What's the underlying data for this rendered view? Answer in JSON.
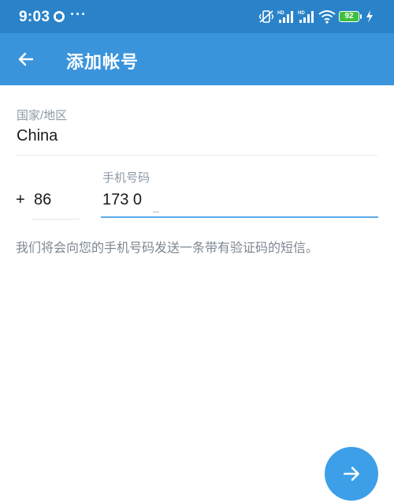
{
  "status_bar": {
    "time": "9:03",
    "more": "···",
    "battery_level": "92"
  },
  "app_bar": {
    "title": "添加帐号"
  },
  "country": {
    "label": "国家/地区",
    "value": "China"
  },
  "phone": {
    "plus": "+",
    "country_code": "86",
    "label": "手机号码",
    "number": "173 0"
  },
  "info_text": "我们将会向您的手机号码发送一条带有验证码的短信。",
  "colors": {
    "status_bar": "#2a83c9",
    "app_bar": "#3a94dc",
    "accent": "#3d9fe8"
  }
}
